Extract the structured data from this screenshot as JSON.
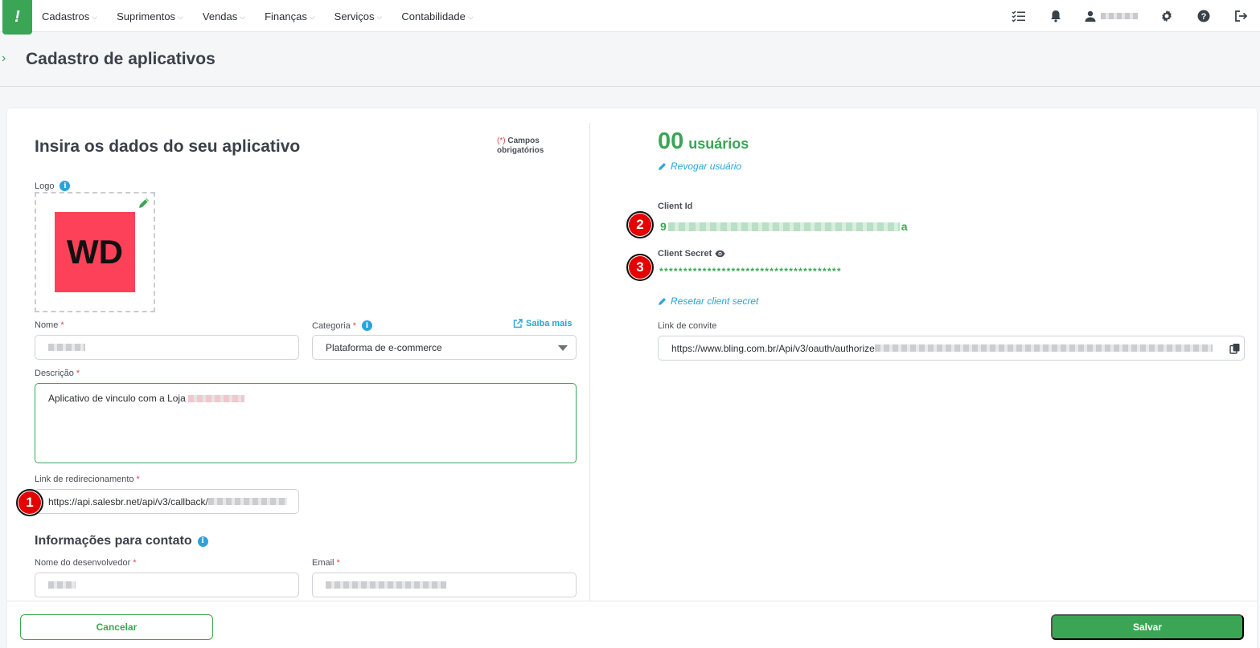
{
  "nav": {
    "logo_glyph": "!",
    "menu": [
      {
        "label": "Cadastros"
      },
      {
        "label": "Suprimentos"
      },
      {
        "label": "Vendas"
      },
      {
        "label": "Finanças"
      },
      {
        "label": "Serviços"
      },
      {
        "label": "Contabilidade"
      }
    ]
  },
  "breadcrumb": {
    "arrow": "› ",
    "title": "Cadastro de aplicativos"
  },
  "form": {
    "title": "Insira os dados do seu aplicativo",
    "required_note_ast": "(*) ",
    "required_note": "Campos obrigatórios",
    "logo_label": "Logo",
    "logo_text": "WD",
    "nome_label": "Nome",
    "categoria_label": "Categoria",
    "categoria_value": "Plataforma de e-commerce",
    "saiba_mais": "Saiba mais",
    "descricao_label": "Descrição",
    "descricao_value": "Aplicativo de vinculo com a Loja",
    "redirect_label": "Link de redirecionamento",
    "redirect_value": "https://api.salesbr.net/api/v3/callback/",
    "contact_title": "Informações para contato",
    "dev_name_label": "Nome do desenvolvedor",
    "email_label": "Email",
    "asterisk": "*"
  },
  "right": {
    "users_count": "00",
    "users_label": "usuários",
    "revoke": "Revogar usuário",
    "client_id_label": "Client Id",
    "client_id_start": "9",
    "client_id_end": "a",
    "client_secret_label": "Client Secret",
    "client_secret_value": "**************************************",
    "reset_secret": "Resetar client secret",
    "invite_label": "Link de convite",
    "invite_value": "https://www.bling.com.br/Api/v3/oauth/authorize"
  },
  "markers": [
    "1",
    "2",
    "3"
  ],
  "footer": {
    "cancel": "Cancelar",
    "save": "Salvar"
  },
  "colors": {
    "brand": "#3aa655",
    "info": "#2aa3d8",
    "required": "#e2484c",
    "marker": "#e40000"
  }
}
